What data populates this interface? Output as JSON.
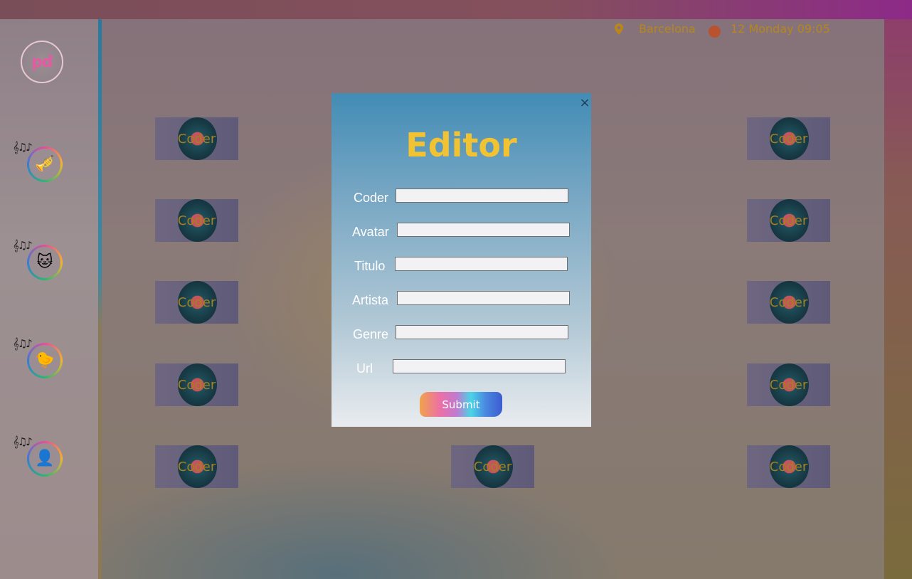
{
  "header": {
    "location_icon": "map-pin-icon",
    "location": "Barcelona",
    "datetime": "12 Monday 09:05",
    "accent_color": "#b8861b",
    "status_dot_color": "#b8522f"
  },
  "sidebar": {
    "logo_text_pd": "pd",
    "items": [
      {
        "icon": "music-instruments-icon",
        "glyph": "🎺"
      },
      {
        "icon": "cat-headphones-icon",
        "glyph": "🐱"
      },
      {
        "icon": "rubber-duck-icon",
        "glyph": "🐤"
      },
      {
        "icon": "add-user-icon",
        "glyph": "👤"
      }
    ]
  },
  "cards": {
    "label": "Coder"
  },
  "modal": {
    "close_glyph": "×",
    "title": "Editor",
    "fields": [
      {
        "label": "Coder",
        "value": ""
      },
      {
        "label": "Avatar",
        "value": ""
      },
      {
        "label": "Titulo",
        "value": ""
      },
      {
        "label": "Artista",
        "value": ""
      },
      {
        "label": "Genre",
        "value": ""
      },
      {
        "label": "Url",
        "value": ""
      }
    ],
    "submit_label": "Submit"
  }
}
